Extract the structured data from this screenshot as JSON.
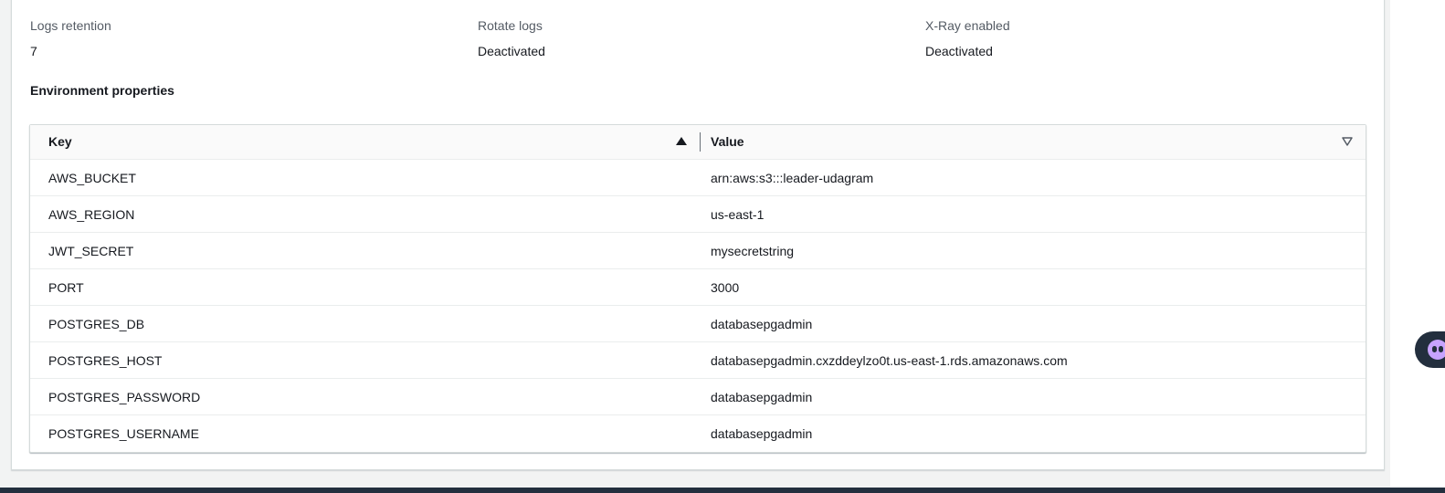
{
  "config": {
    "logs_retention": {
      "label": "Logs retention",
      "value": "7"
    },
    "rotate_logs": {
      "label": "Rotate logs",
      "value": "Deactivated"
    },
    "xray": {
      "label": "X-Ray enabled",
      "value": "Deactivated"
    }
  },
  "env": {
    "title": "Environment properties",
    "columns": {
      "key": "Key",
      "value": "Value"
    },
    "rows": [
      {
        "key": "AWS_BUCKET",
        "value": "arn:aws:s3:::leader-udagram"
      },
      {
        "key": "AWS_REGION",
        "value": "us-east-1"
      },
      {
        "key": "JWT_SECRET",
        "value": "mysecretstring"
      },
      {
        "key": "PORT",
        "value": "3000"
      },
      {
        "key": "POSTGRES_DB",
        "value": "databasepgadmin"
      },
      {
        "key": "POSTGRES_HOST",
        "value": "databasepgadmin.cxzddeylzo0t.us-east-1.rds.amazonaws.com"
      },
      {
        "key": "POSTGRES_PASSWORD",
        "value": "databasepgadmin"
      },
      {
        "key": "POSTGRES_USERNAME",
        "value": "databasepgadmin"
      }
    ]
  },
  "icons": {
    "sort_ascending": "sort-ascending-icon",
    "sort_none": "sort-none-icon",
    "feedback": "feedback-face-icon"
  },
  "colors": {
    "header_bg": "#fafafa",
    "nav_bar": "#232f3e",
    "label_text": "#545b64"
  }
}
